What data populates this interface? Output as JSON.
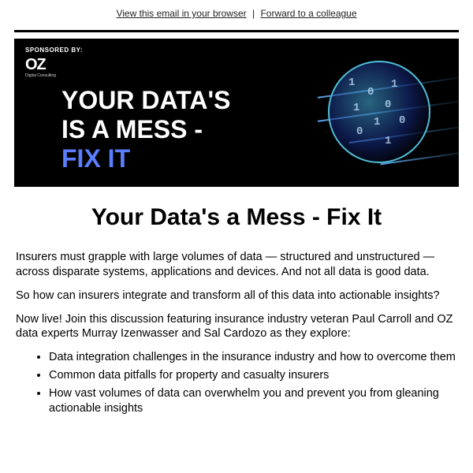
{
  "topLinks": {
    "viewInBrowser": "View this email in your browser",
    "separator": "|",
    "forward": "Forward to a colleague"
  },
  "banner": {
    "sponsorLabel": "SPONSORED BY:",
    "logoMain": "OZ",
    "logoSub": "Digital Consulting",
    "line1": "YOUR DATA'S",
    "line2": "IS A MESS -",
    "line3": "FIX IT"
  },
  "headline": "Your Data's a Mess - Fix It",
  "paragraphs": {
    "p1": "Insurers must grapple with large volumes of data — structured and unstructured — across disparate systems, applications and devices. And not all data is good data.",
    "p2": "So how can insurers integrate and transform all of this data into actionable insights?",
    "p3": "Now live! Join this discussion featuring insurance industry veteran Paul Carroll and OZ data experts Murray Izenwasser and Sal Cardozo as they explore:"
  },
  "bullets": [
    "Data integration challenges in the insurance industry and how to overcome them",
    "Common data pitfalls for property and casualty insurers",
    "How vast volumes of data can overwhelm you and prevent you from gleaning actionable insights"
  ]
}
